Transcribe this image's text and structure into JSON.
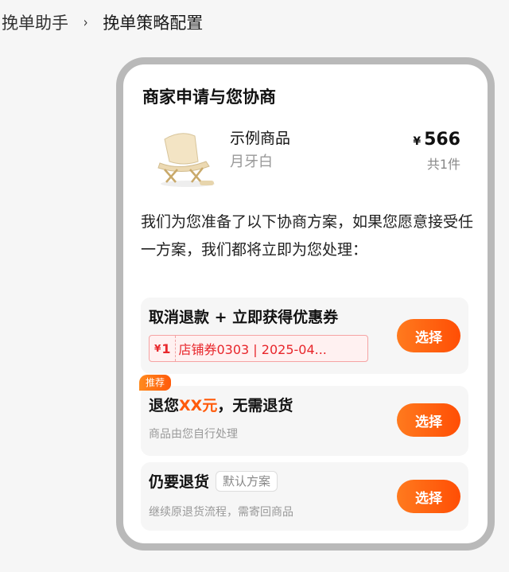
{
  "breadcrumb": {
    "root": "挽单助手",
    "separator": "›",
    "current": "挽单策略配置"
  },
  "card": {
    "title": "商家申请与您协商"
  },
  "product": {
    "image_icon": "folding-chair-icon",
    "name": "示例商品",
    "variant": "月牙白",
    "currency": "¥",
    "price": "566",
    "quantity": "共1件"
  },
  "description": "我们为您准备了以下协商方案，如果您愿意接受任一方案，我们都将立即为您处理：",
  "options": [
    {
      "title": "取消退款 + 立即获得优惠券",
      "coupon_currency": "¥",
      "coupon_amount": "1",
      "coupon_text": "店铺券0303 | 2025-04...",
      "button": "选择"
    },
    {
      "tag": "推荐",
      "title_prefix": "退您",
      "title_amount": "XX元",
      "title_suffix": "，无需退货",
      "subtitle": "商品由您自行处理",
      "button": "选择"
    },
    {
      "title": "仍要退货",
      "tag": "默认方案",
      "subtitle": "继续原退货流程，需寄回商品",
      "button": "选择"
    }
  ],
  "colors": {
    "accent": "#ff5a0a",
    "coupon_red": "#e8262b",
    "phone_frame": "#b9b9b9"
  }
}
